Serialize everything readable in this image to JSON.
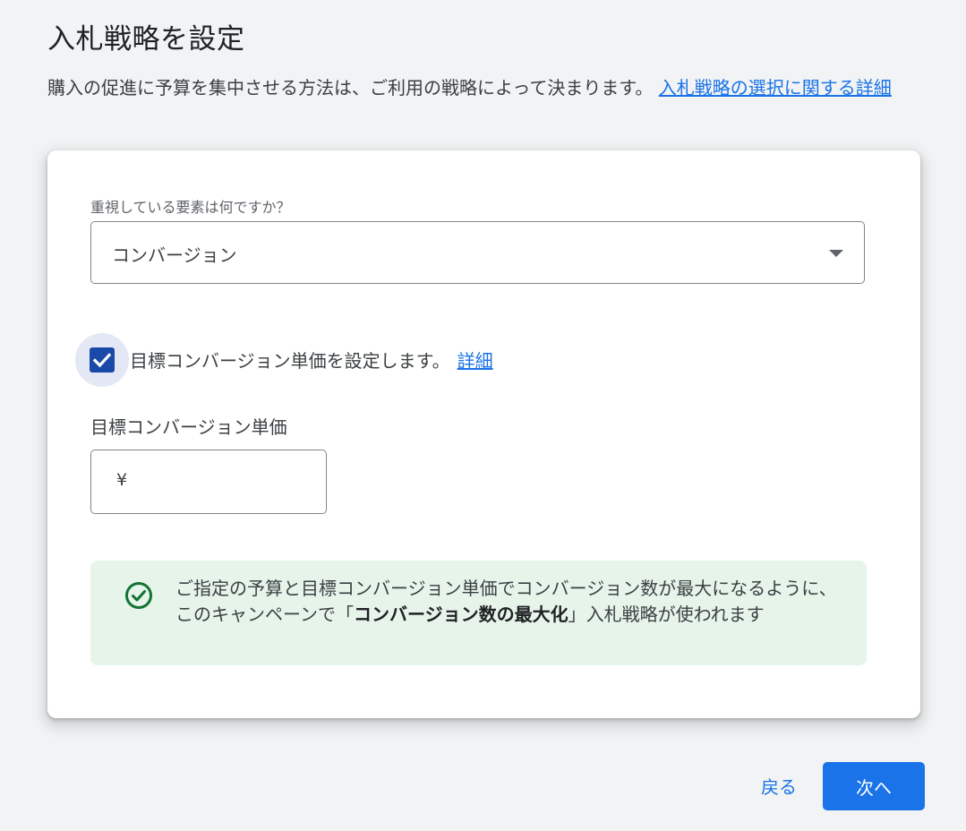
{
  "page": {
    "title": "入札戦略を設定",
    "intro_text": "購入の促進に予算を集中させる方法は、ご利用の戦略によって決まります。 ",
    "intro_link": "入札戦略の選択に関する詳細"
  },
  "focus_select": {
    "label": "重視している要素は何ですか？",
    "value": "コンバージョン"
  },
  "target_cpa_checkbox": {
    "checked": true,
    "label": "目標コンバージョン単価を設定します。",
    "link": "詳細"
  },
  "target_cpa_input": {
    "label": "目標コンバージョン単価",
    "currency": "¥",
    "value": ""
  },
  "notice": {
    "text_before": "ご指定の予算と目標コンバージョン単価でコンバージョン数が最大になるように、このキャンペーンで「",
    "strategy_name": "コンバージョン数の最大化",
    "text_after": "」入札戦略が使われます"
  },
  "footer": {
    "back_label": "戻る",
    "next_label": "次へ"
  },
  "colors": {
    "accent": "#1a73e8",
    "checkbox": "#1a4aa8",
    "success": "#137333",
    "notice_bg": "#e6f4ea"
  }
}
